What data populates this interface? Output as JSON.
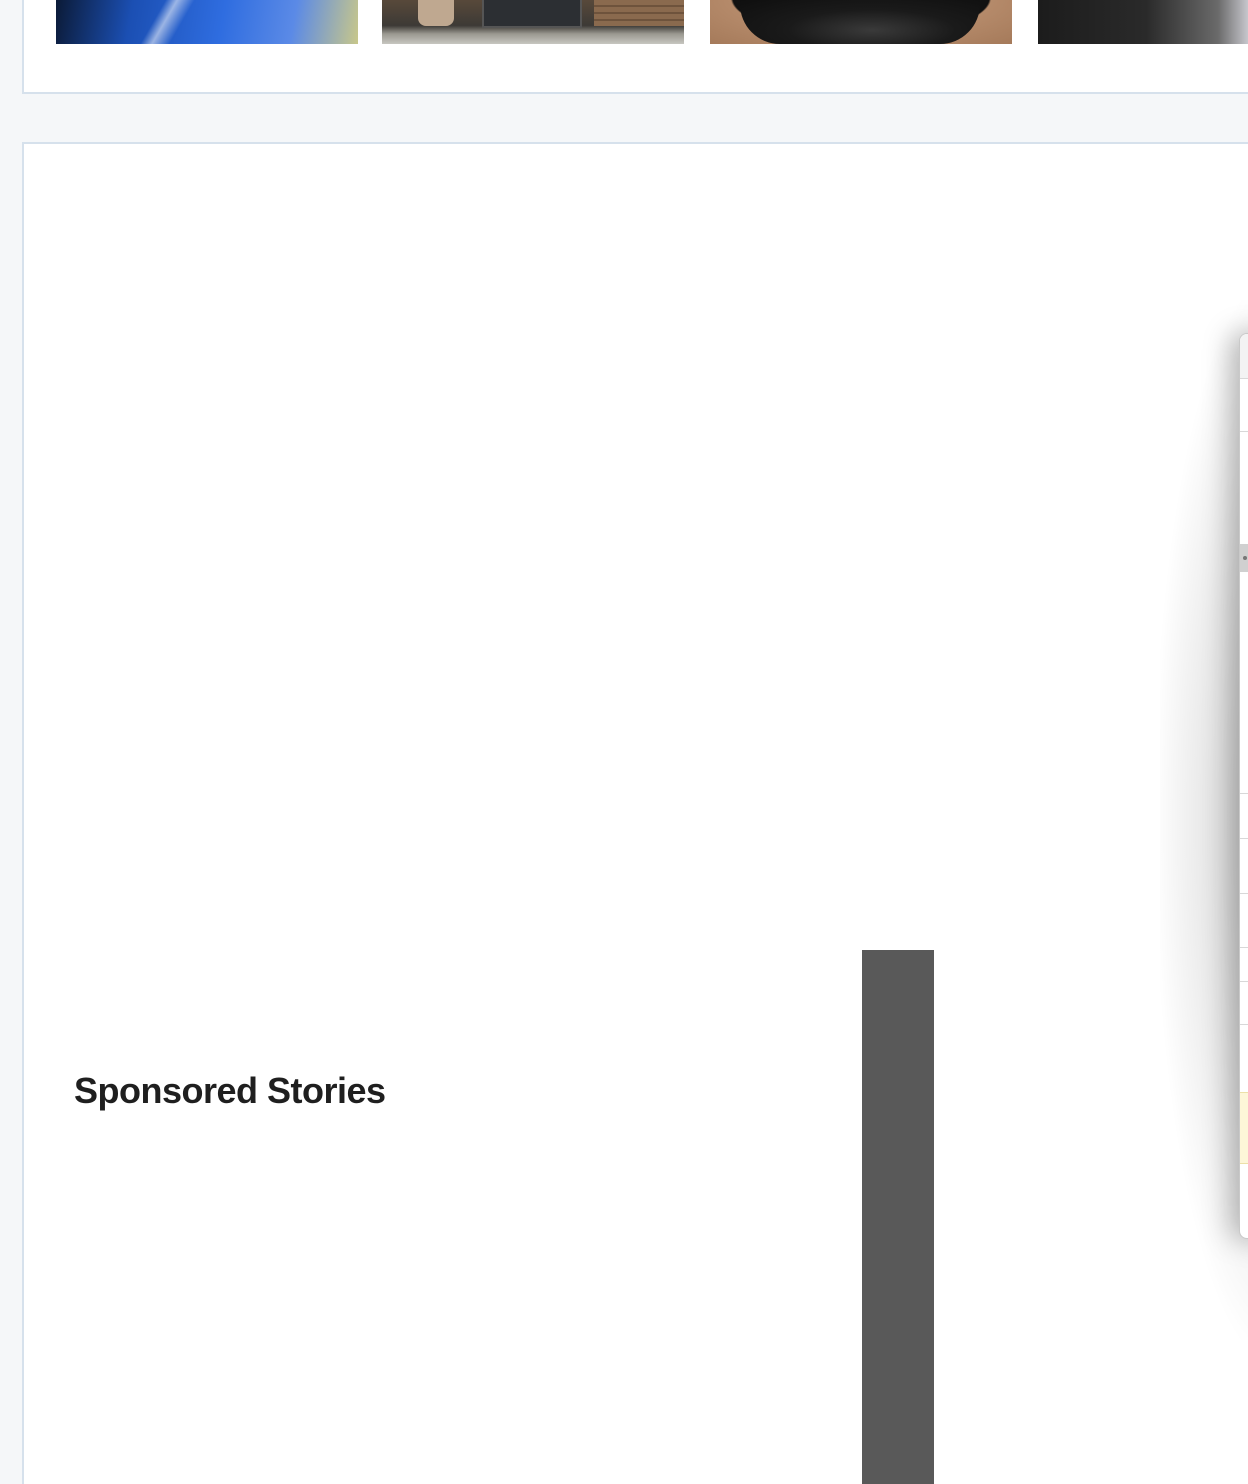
{
  "carousel": {
    "thumbnails": [
      {
        "icon": "blue-abstract-thumbnail"
      },
      {
        "icon": "storefront-thumbnail"
      },
      {
        "icon": "black-dress-thumbnail"
      },
      {
        "icon": "suit-thumbnail"
      }
    ]
  },
  "sponsored": {
    "title": "Sponsored Stories"
  },
  "colors": {
    "page_background": "#f5f7f9",
    "card_border": "#d6e1ec",
    "title_text": "#1f1f1f",
    "ad_bar": "#595959"
  }
}
